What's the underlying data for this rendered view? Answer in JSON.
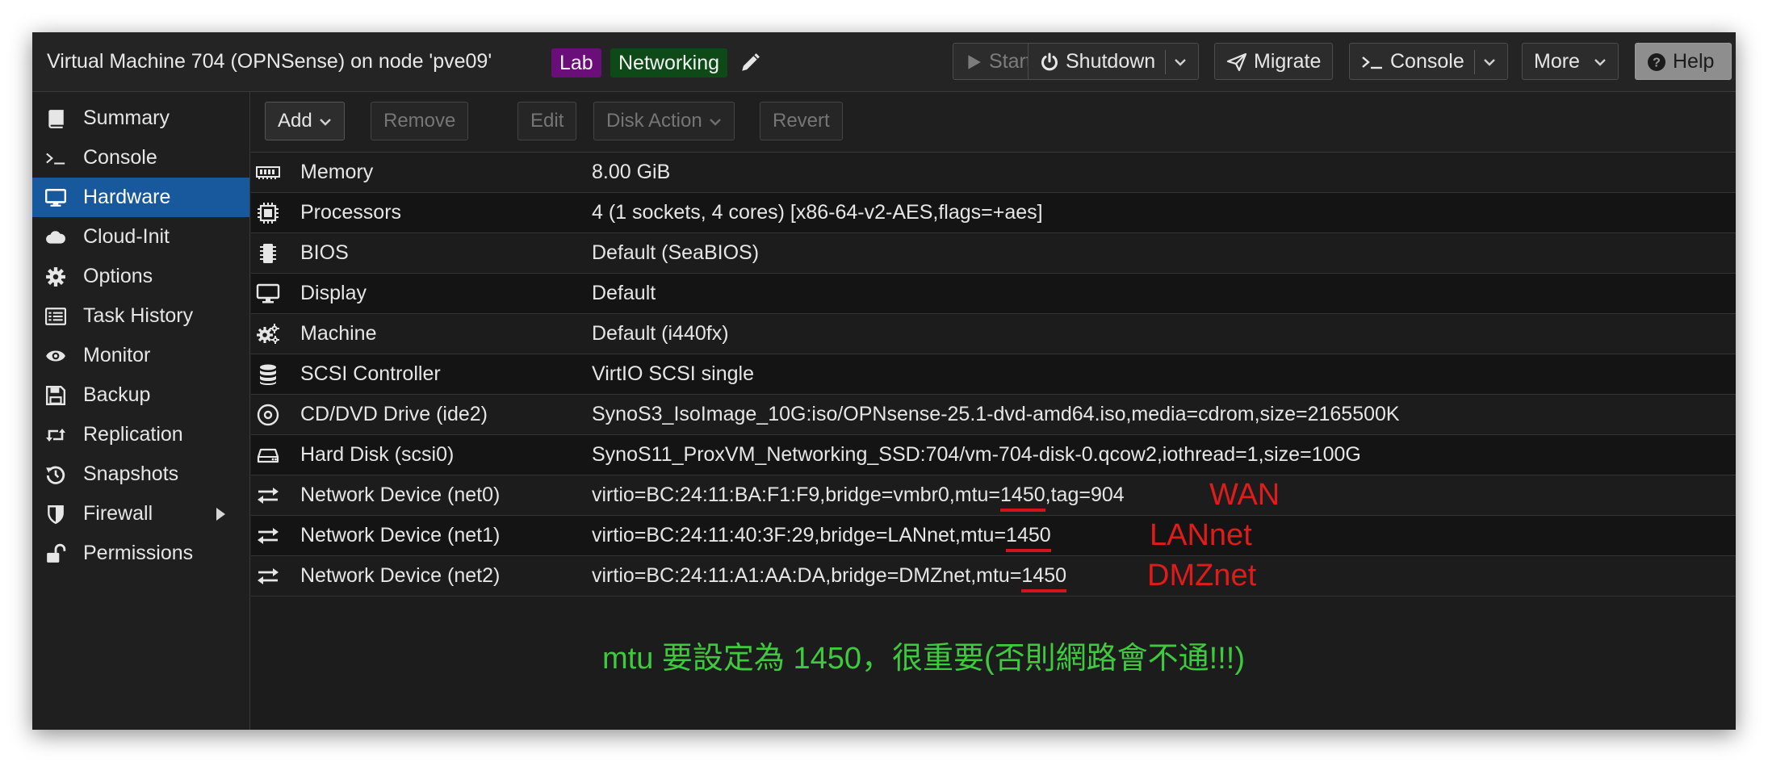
{
  "header": {
    "title": "Virtual Machine 704 (OPNSense) on node 'pve09'",
    "tags": [
      "Lab",
      "Networking"
    ],
    "buttons": {
      "start": "Start",
      "shutdown": "Shutdown",
      "migrate": "Migrate",
      "console": "Console",
      "more": "More",
      "help": "Help"
    }
  },
  "sidebar": {
    "items": [
      {
        "label": "Summary",
        "icon": "book-icon"
      },
      {
        "label": "Console",
        "icon": "terminal-icon"
      },
      {
        "label": "Hardware",
        "icon": "desktop-icon",
        "active": true
      },
      {
        "label": "Cloud-Init",
        "icon": "cloud-icon"
      },
      {
        "label": "Options",
        "icon": "gear-icon"
      },
      {
        "label": "Task History",
        "icon": "list-icon"
      },
      {
        "label": "Monitor",
        "icon": "eye-icon"
      },
      {
        "label": "Backup",
        "icon": "floppy-icon"
      },
      {
        "label": "Replication",
        "icon": "retweet-icon"
      },
      {
        "label": "Snapshots",
        "icon": "history-icon"
      },
      {
        "label": "Firewall",
        "icon": "shield-icon"
      },
      {
        "label": "Permissions",
        "icon": "unlock-icon"
      }
    ]
  },
  "toolbar": {
    "add": "Add",
    "remove": "Remove",
    "edit": "Edit",
    "disk_action": "Disk Action",
    "revert": "Revert"
  },
  "hardware": [
    {
      "name": "Memory",
      "value": "8.00 GiB",
      "icon": "memory-icon"
    },
    {
      "name": "Processors",
      "value": "4 (1 sockets, 4 cores) [x86-64-v2-AES,flags=+aes]",
      "icon": "cpu-icon"
    },
    {
      "name": "BIOS",
      "value": "Default (SeaBIOS)",
      "icon": "microchip-icon"
    },
    {
      "name": "Display",
      "value": "Default",
      "icon": "desktop-icon"
    },
    {
      "name": "Machine",
      "value": "Default (i440fx)",
      "icon": "cogs-icon"
    },
    {
      "name": "SCSI Controller",
      "value": "VirtIO SCSI single",
      "icon": "database-icon"
    },
    {
      "name": "CD/DVD Drive (ide2)",
      "value": "SynoS3_IsoImage_10G:iso/OPNsense-25.1-dvd-amd64.iso,media=cdrom,size=2165500K",
      "icon": "cdrom-icon"
    },
    {
      "name": "Hard Disk (scsi0)",
      "value": "SynoS11_ProxVM_Networking_SSD:704/vm-704-disk-0.qcow2,iothread=1,size=100G",
      "icon": "hdd-icon"
    },
    {
      "name": "Network Device (net0)",
      "value_pre": "virtio=BC:24:11:BA:F1:F9,bridge=vmbr0,mtu=",
      "mtu": "1450",
      "value_post": ",tag=904",
      "note": "WAN",
      "icon": "exchange-icon"
    },
    {
      "name": "Network Device (net1)",
      "value_pre": "virtio=BC:24:11:40:3F:29,bridge=LANnet,mtu=",
      "mtu": "1450",
      "value_post": "",
      "note": "LANnet",
      "icon": "exchange-icon"
    },
    {
      "name": "Network Device (net2)",
      "value_pre": "virtio=BC:24:11:A1:AA:DA,bridge=DMZnet,mtu=",
      "mtu": "1450",
      "value_post": "",
      "note": "DMZnet",
      "icon": "exchange-icon"
    }
  ],
  "annotation": "mtu 要設定為 1450，很重要(否則網路會不通!!!)",
  "colors": {
    "accent": "#18589c",
    "annotation_red": "#e01b1b",
    "annotation_green": "#3ec93e",
    "tag_lab": "#6a0f7a",
    "tag_networking": "#0e4a18"
  }
}
